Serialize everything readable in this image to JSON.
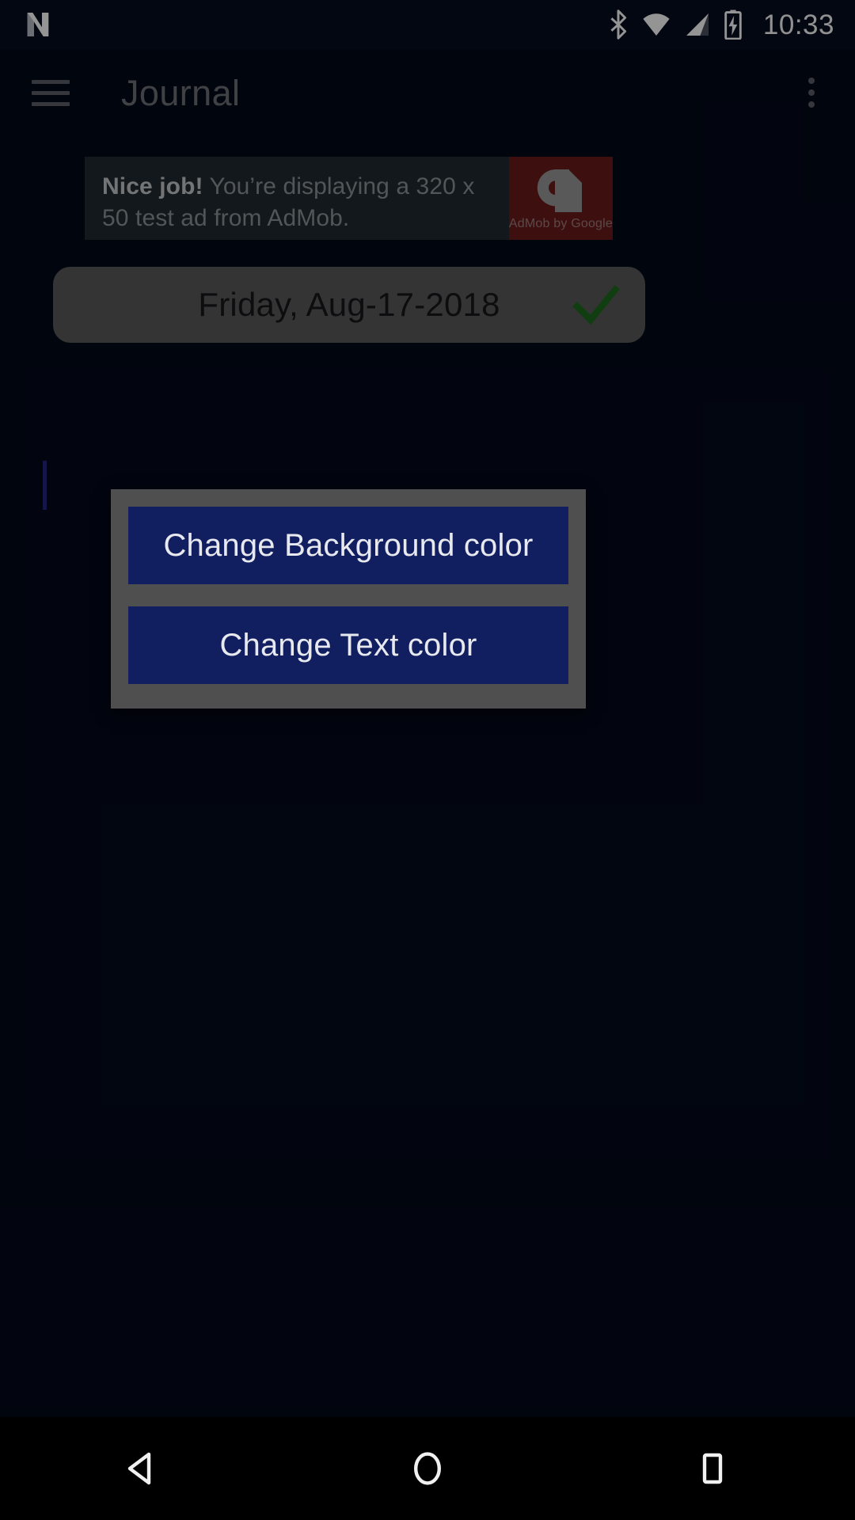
{
  "status_bar": {
    "notification_icon": "android-n-logo-icon",
    "bluetooth_icon": "bluetooth-icon",
    "wifi_icon": "wifi-icon",
    "signal_icon": "cell-signal-icon",
    "battery_icon": "battery-charging-icon",
    "clock": "10:33"
  },
  "app_bar": {
    "menu_icon": "hamburger-menu-icon",
    "title": "Journal",
    "overflow_icon": "overflow-menu-icon"
  },
  "ad_banner": {
    "headline": "Nice job!",
    "body": " You’re displaying a 320 x 50 test ad from AdMob.",
    "logo_icon": "admob-logo-icon",
    "logo_caption": "AdMob by Google",
    "colors": {
      "text_background": "#202a30",
      "logo_background": "#6c1b1b"
    }
  },
  "date_bar": {
    "date": "Friday, Aug-17-2018",
    "confirm_icon": "green-checkmark-icon",
    "colors": {
      "background": "#5b5b5b",
      "text": "#17171b",
      "check": "#1d6b1d"
    }
  },
  "editor": {
    "value": "",
    "caret_color": "#21267a"
  },
  "dialog": {
    "buttons": [
      {
        "label": "Change Background color",
        "name": "change-background-color-button"
      },
      {
        "label": "Change Text color",
        "name": "change-text-color-button"
      }
    ],
    "colors": {
      "panel": "#4f4f4f",
      "button": "#111f61",
      "button_text": "#e8e9ee"
    }
  },
  "nav_bar": {
    "back_icon": "back-triangle-icon",
    "home_icon": "home-circle-icon",
    "recents_icon": "recents-square-icon"
  }
}
